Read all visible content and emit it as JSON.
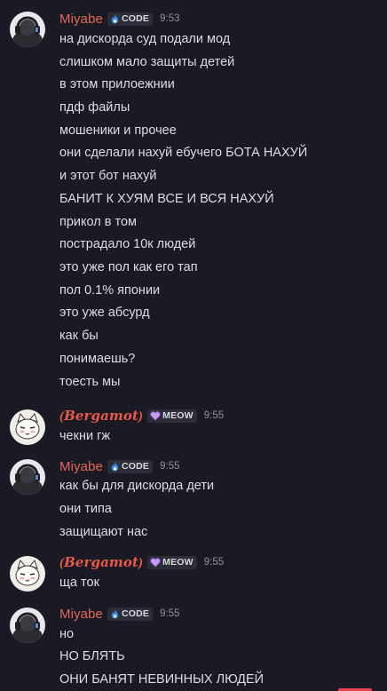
{
  "accent_colors": {
    "miyabe_name": "#e06a57",
    "bergamot_name": "#e8594a",
    "background": "#1b1a24",
    "tag_background": "#2d2d3a"
  },
  "groups": [
    {
      "author": "Miyabe",
      "avatar": "headphones-avatar",
      "tag": {
        "icon": "flame-icon",
        "label": "CODE"
      },
      "time": "9:53",
      "lines": [
        "на дискорда суд подали мод",
        "слишком мало защиты детей",
        "в этом прилоежнии",
        "пдф файлы",
        "мошеники и прочее",
        "они сделали нахуй ебучего БОТА НАХУЙ",
        "и этот бот нахуй",
        "БАНИТ К ХУЯМ ВСЕ И ВСЯ НАХУЙ",
        "прикол в том",
        "пострадало 10к людей",
        "это уже пол как его тап",
        "пол 0.1% японии",
        "это уже абсурд",
        "как бы",
        "понимаешь?",
        "тоесть мы"
      ]
    },
    {
      "author": "(𝑩𝒆𝒓𝒈𝒂𝒎𝒐𝒕)",
      "avatar": "cat-avatar",
      "tag": {
        "icon": "heart-icon",
        "label": "MEOW"
      },
      "time": "9:55",
      "lines": [
        "чекни гж"
      ]
    },
    {
      "author": "Miyabe",
      "avatar": "headphones-avatar",
      "tag": {
        "icon": "flame-icon",
        "label": "CODE"
      },
      "time": "9:55",
      "lines": [
        "как бы для дискорда дети",
        "они типа",
        "защищают нас"
      ]
    },
    {
      "author": "(𝑩𝒆𝒓𝒈𝒂𝒎𝒐𝒕)",
      "avatar": "cat-avatar",
      "tag": {
        "icon": "heart-icon",
        "label": "MEOW"
      },
      "time": "9:55",
      "lines": [
        "ща ток"
      ]
    },
    {
      "author": "Miyabe",
      "avatar": "headphones-avatar",
      "tag": {
        "icon": "flame-icon",
        "label": "CODE"
      },
      "time": "9:55",
      "lines": [
        "но",
        "НО БЛЯТЬ",
        "ОНИ БАНЯТ НЕВИННЫХ ЛЮДЕЙ"
      ]
    }
  ]
}
